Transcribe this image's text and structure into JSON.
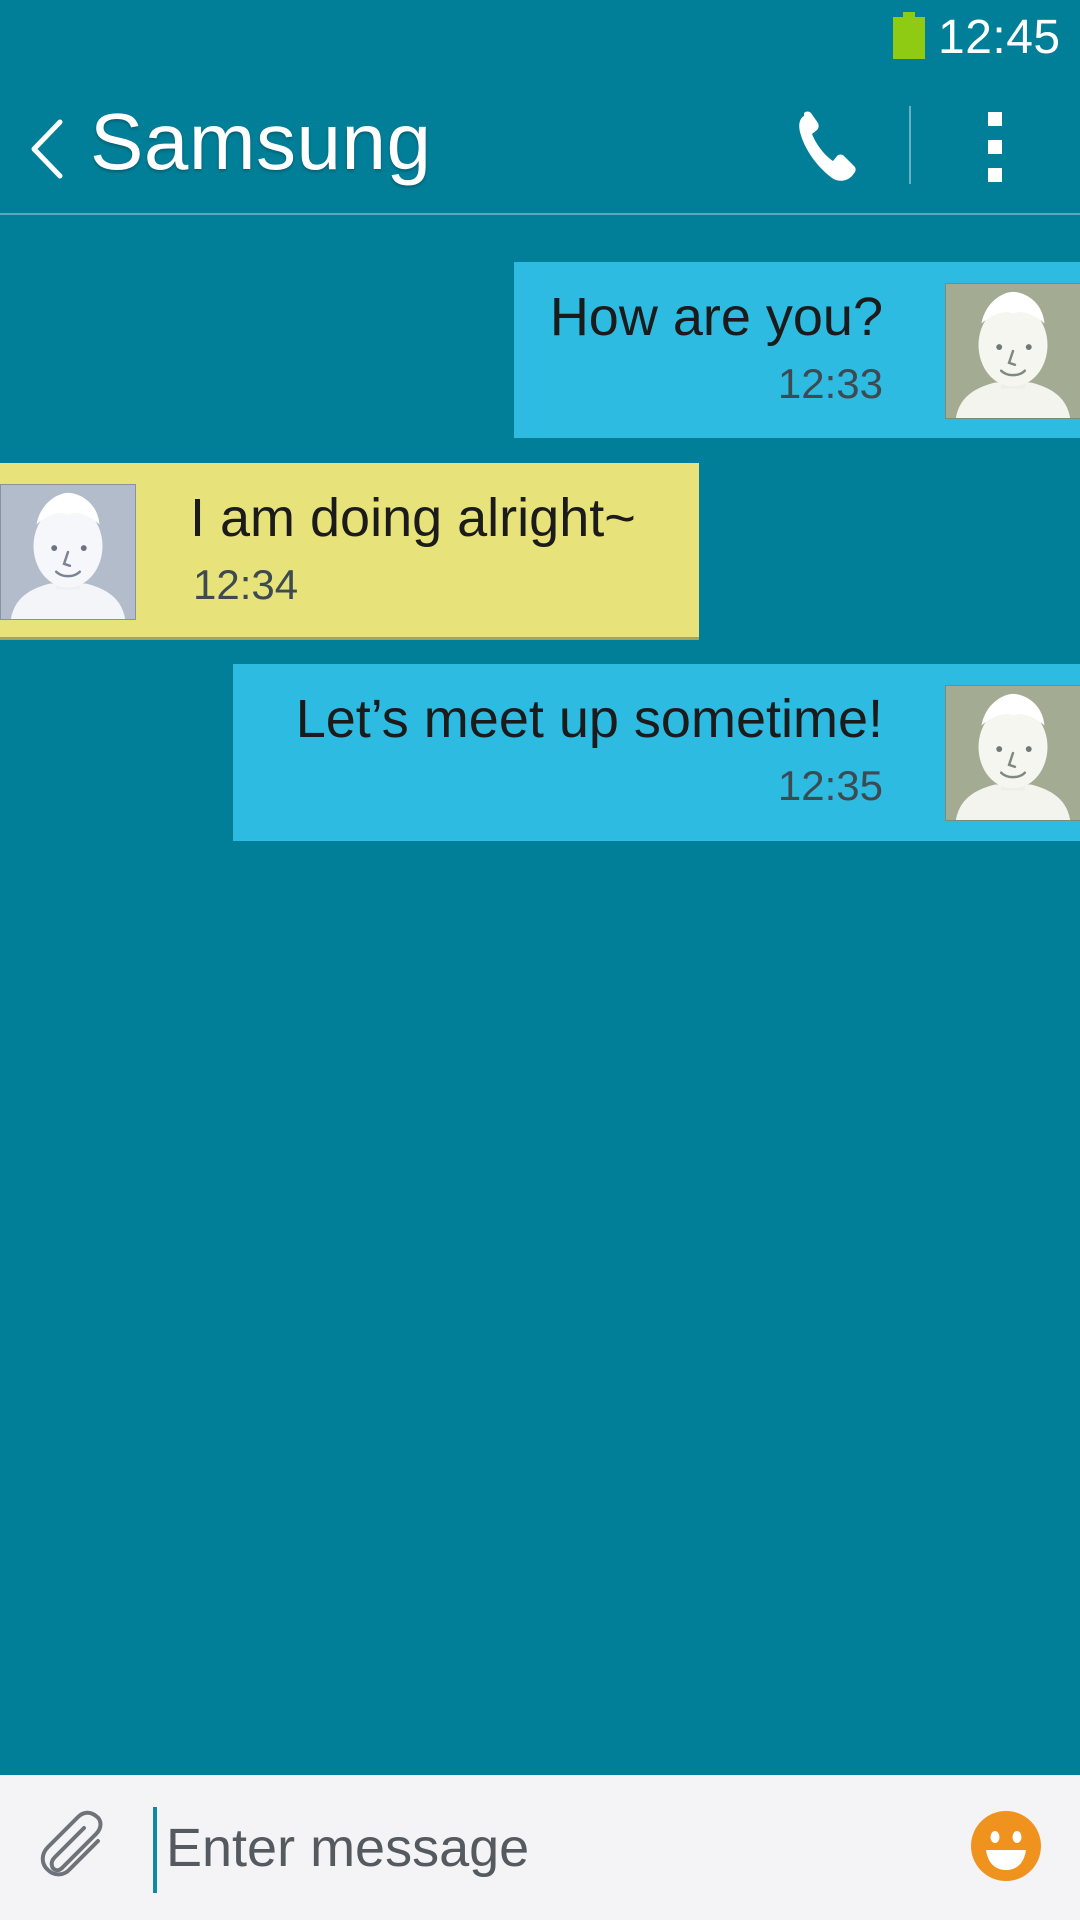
{
  "status_bar": {
    "time": "12:45",
    "battery_icon": "battery-full-icon",
    "battery_color": "#8fcb12"
  },
  "header": {
    "back_icon": "chevron-left-icon",
    "contact_name": "Samsung",
    "call_icon": "phone-icon",
    "more_icon": "overflow-menu-icon"
  },
  "colors": {
    "background": "#027f98",
    "sent_bubble": "#2ebbe1",
    "received_bubble": "#e7e279",
    "emoji_accent": "#f0921e"
  },
  "messages": [
    {
      "direction": "sent",
      "text": "How are you?",
      "time": "12:33",
      "avatar_icon": "default-contact-avatar-icon"
    },
    {
      "direction": "received",
      "text": "I am doing alright~",
      "time": "12:34",
      "avatar_icon": "default-contact-avatar-icon"
    },
    {
      "direction": "sent",
      "text": "Let’s meet up sometime!",
      "time": "12:35",
      "avatar_icon": "default-contact-avatar-icon"
    }
  ],
  "compose": {
    "attach_icon": "paperclip-icon",
    "placeholder": "Enter message",
    "value": "",
    "emoji_icon": "smiley-emoji-icon"
  }
}
